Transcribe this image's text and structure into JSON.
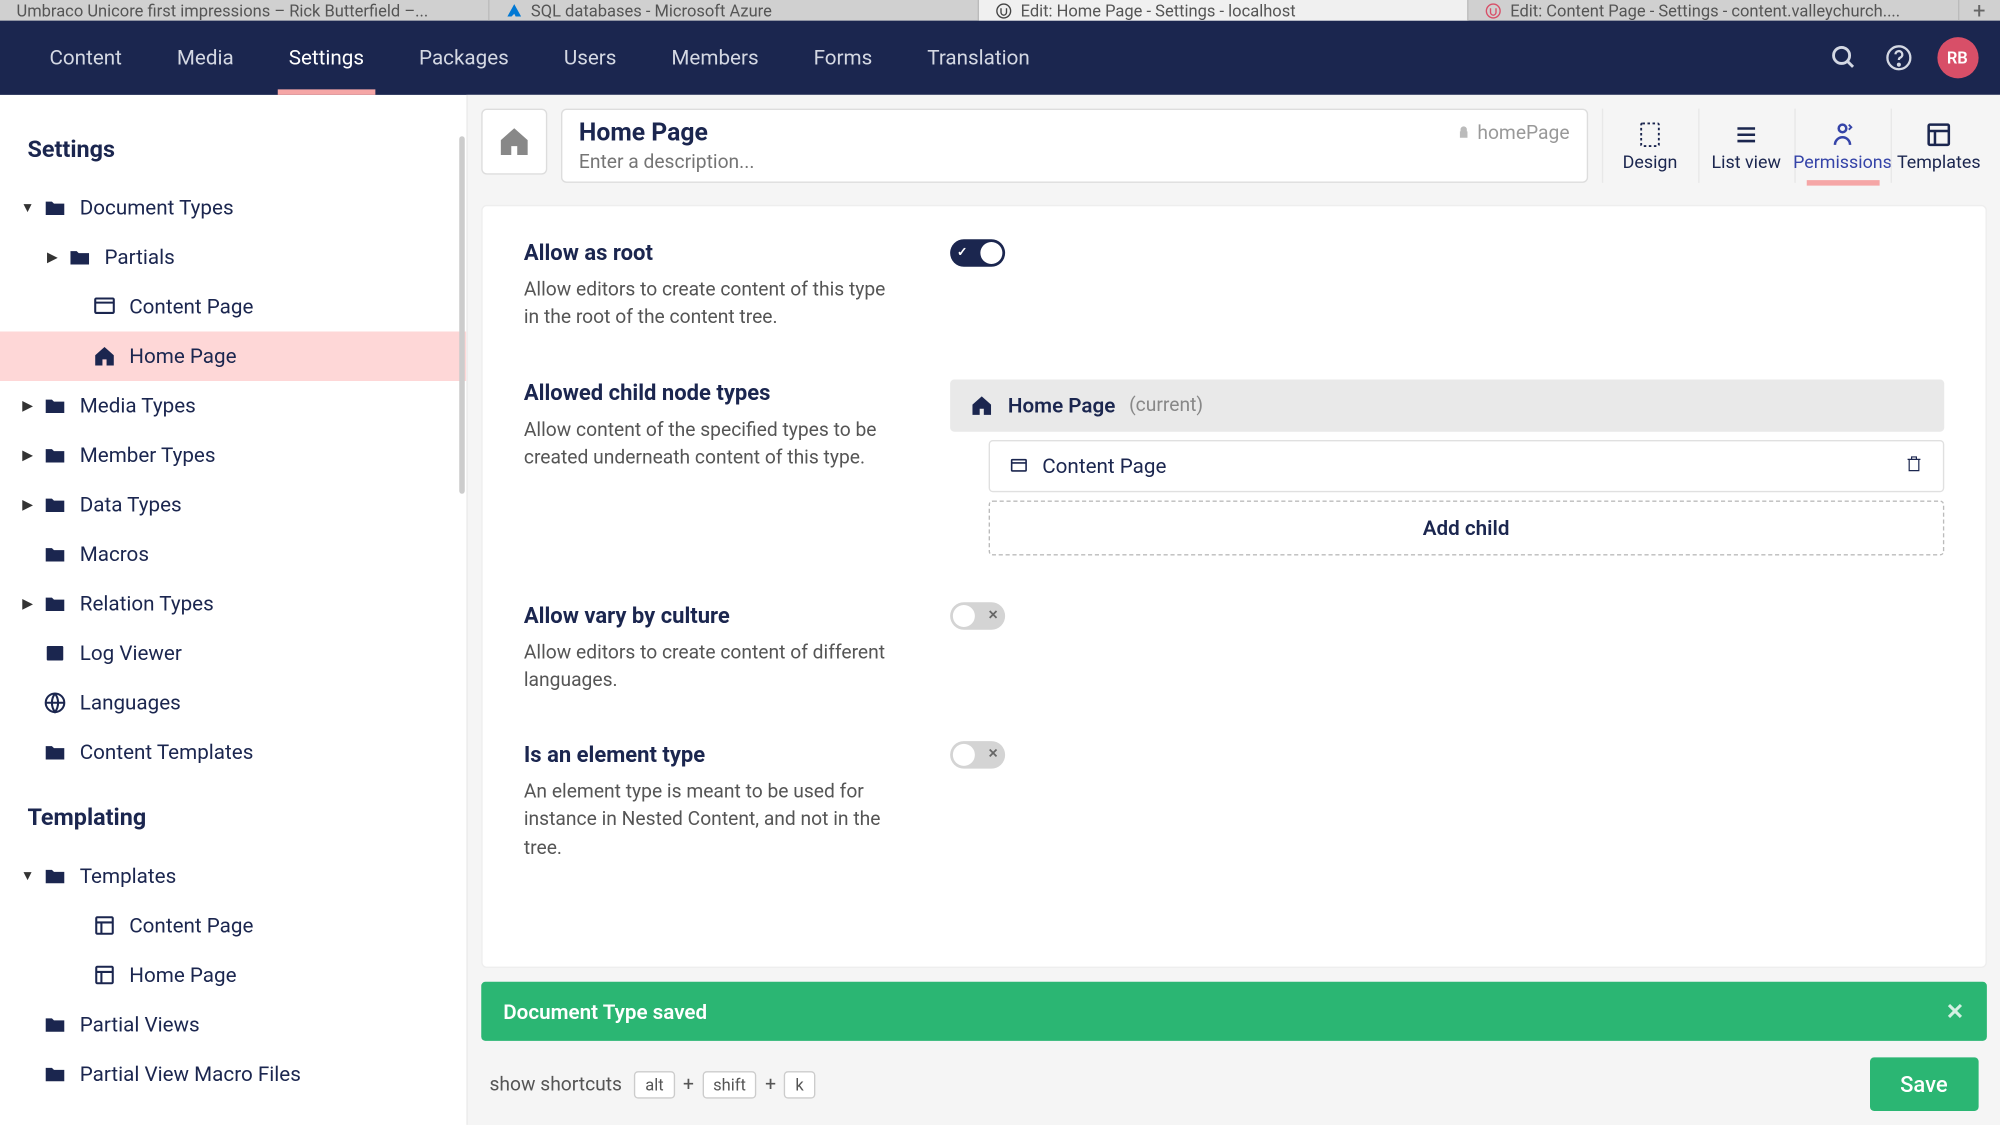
{
  "browserTabs": {
    "tabs": [
      {
        "label": "Umbraco Unicore first impressions – Rick Butterfield –..."
      },
      {
        "label": "SQL databases - Microsoft Azure"
      },
      {
        "label": "Edit: Home Page - Settings - localhost"
      },
      {
        "label": "Edit: Content Page - Settings - content.valleychurch...."
      }
    ],
    "newTab": "+"
  },
  "topnav": {
    "items": [
      "Content",
      "Media",
      "Settings",
      "Packages",
      "Users",
      "Members",
      "Forms",
      "Translation"
    ],
    "activeIndex": 2,
    "avatar": "RB"
  },
  "sidebar": {
    "heading1": "Settings",
    "heading2": "Templating",
    "tree": {
      "documentTypes": "Document Types",
      "partials": "Partials",
      "contentPage": "Content Page",
      "homePage": "Home Page",
      "mediaTypes": "Media Types",
      "memberTypes": "Member Types",
      "dataTypes": "Data Types",
      "macros": "Macros",
      "relationTypes": "Relation Types",
      "logViewer": "Log Viewer",
      "languages": "Languages",
      "contentTemplates": "Content Templates",
      "templates": "Templates",
      "tplContentPage": "Content Page",
      "tplHomePage": "Home Page",
      "partialViews": "Partial Views",
      "partialViewMacroFiles": "Partial View Macro Files"
    }
  },
  "editor": {
    "title": "Home Page",
    "alias": "homePage",
    "descPlaceholder": "Enter a description...",
    "tabs": {
      "design": "Design",
      "listView": "List view",
      "permissions": "Permissions",
      "templates": "Templates"
    }
  },
  "permissions": {
    "allowAsRoot": {
      "title": "Allow as root",
      "desc": "Allow editors to create content of this type in the root of the content tree."
    },
    "allowedChildren": {
      "title": "Allowed child node types",
      "desc": "Allow content of the specified types to be created underneath content of this type.",
      "parent": "Home Page",
      "current": "(current)",
      "child": "Content Page",
      "addChild": "Add child"
    },
    "varyByCulture": {
      "title": "Allow vary by culture",
      "desc": "Allow editors to create content of different languages."
    },
    "isElement": {
      "title": "Is an element type",
      "desc": "An element type is meant to be used for instance in Nested Content, and not in the tree."
    }
  },
  "toast": {
    "message": "Document Type saved"
  },
  "footer": {
    "label": "show shortcuts",
    "keys": [
      "alt",
      "shift",
      "k"
    ],
    "save": "Save"
  }
}
